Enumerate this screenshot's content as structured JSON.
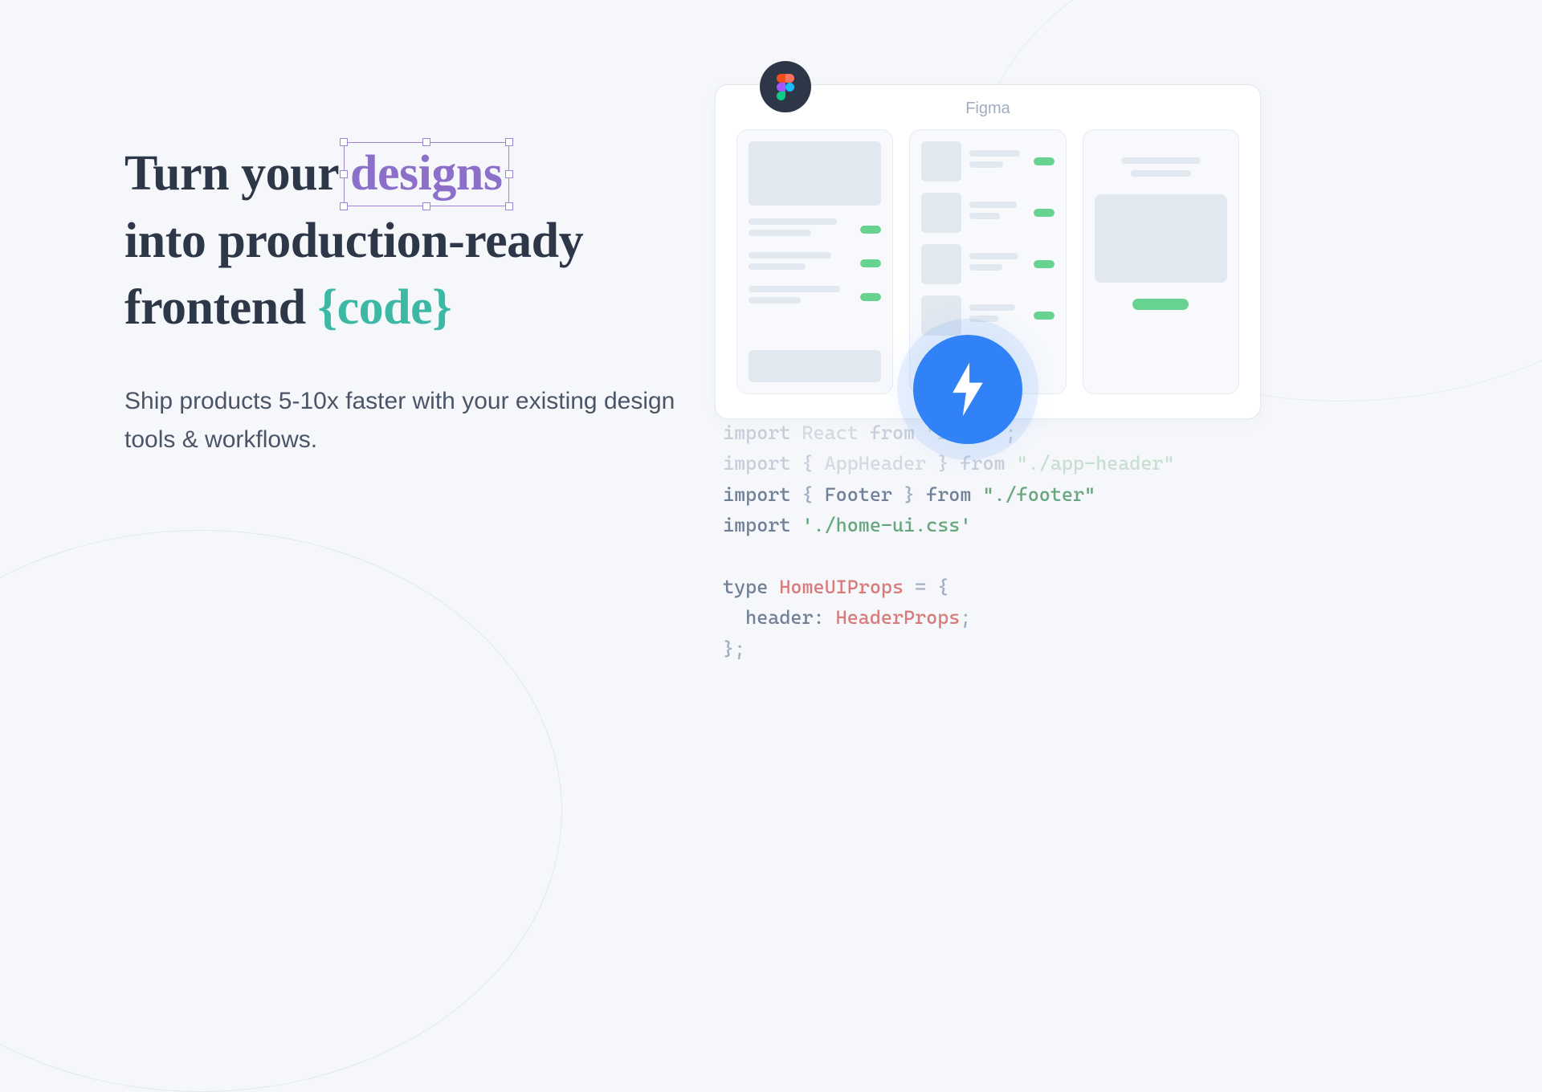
{
  "headline": {
    "part1": "Turn your",
    "designs": "designs",
    "part2": "into production-ready",
    "part3": "frontend",
    "code": "{code}"
  },
  "subheadline": "Ship products 5-10x faster with your existing design tools & workflows.",
  "figma": {
    "label": "Figma",
    "badge_name": "figma-logo"
  },
  "lightning": {
    "icon_name": "lightning-bolt",
    "color": "#3182f6"
  },
  "code": {
    "lines": [
      {
        "tokens": [
          {
            "t": "import ",
            "c": "kw"
          },
          {
            "t": "React",
            "c": "id"
          },
          {
            "t": " from ",
            "c": "kw"
          },
          {
            "t": "\"react\"",
            "c": "str"
          },
          {
            "t": ";",
            "c": "punc"
          }
        ],
        "faded": true
      },
      {
        "tokens": [
          {
            "t": "import ",
            "c": "kw"
          },
          {
            "t": "{ ",
            "c": "punc"
          },
          {
            "t": "AppHeader",
            "c": "id"
          },
          {
            "t": " } ",
            "c": "punc"
          },
          {
            "t": "from ",
            "c": "kw"
          },
          {
            "t": "\"./app-header\"",
            "c": "str"
          }
        ],
        "faded": true
      },
      {
        "tokens": [
          {
            "t": "import ",
            "c": "kw"
          },
          {
            "t": "{ ",
            "c": "punc"
          },
          {
            "t": "Footer",
            "c": "id"
          },
          {
            "t": " } ",
            "c": "punc"
          },
          {
            "t": "from ",
            "c": "kw"
          },
          {
            "t": "\"./footer\"",
            "c": "str"
          }
        ],
        "faded": false
      },
      {
        "tokens": [
          {
            "t": "import ",
            "c": "kw"
          },
          {
            "t": "'./home-ui.css'",
            "c": "str"
          }
        ],
        "faded": false
      },
      {
        "tokens": [
          {
            "t": " ",
            "c": "punc"
          }
        ],
        "faded": false
      },
      {
        "tokens": [
          {
            "t": "type ",
            "c": "kw"
          },
          {
            "t": "HomeUIProps",
            "c": "type"
          },
          {
            "t": " = {",
            "c": "punc"
          }
        ],
        "faded": false
      },
      {
        "tokens": [
          {
            "t": "  header: ",
            "c": "id"
          },
          {
            "t": "HeaderProps",
            "c": "type"
          },
          {
            "t": ";",
            "c": "punc"
          }
        ],
        "faded": false
      },
      {
        "tokens": [
          {
            "t": "};",
            "c": "punc"
          }
        ],
        "faded": false
      }
    ]
  }
}
